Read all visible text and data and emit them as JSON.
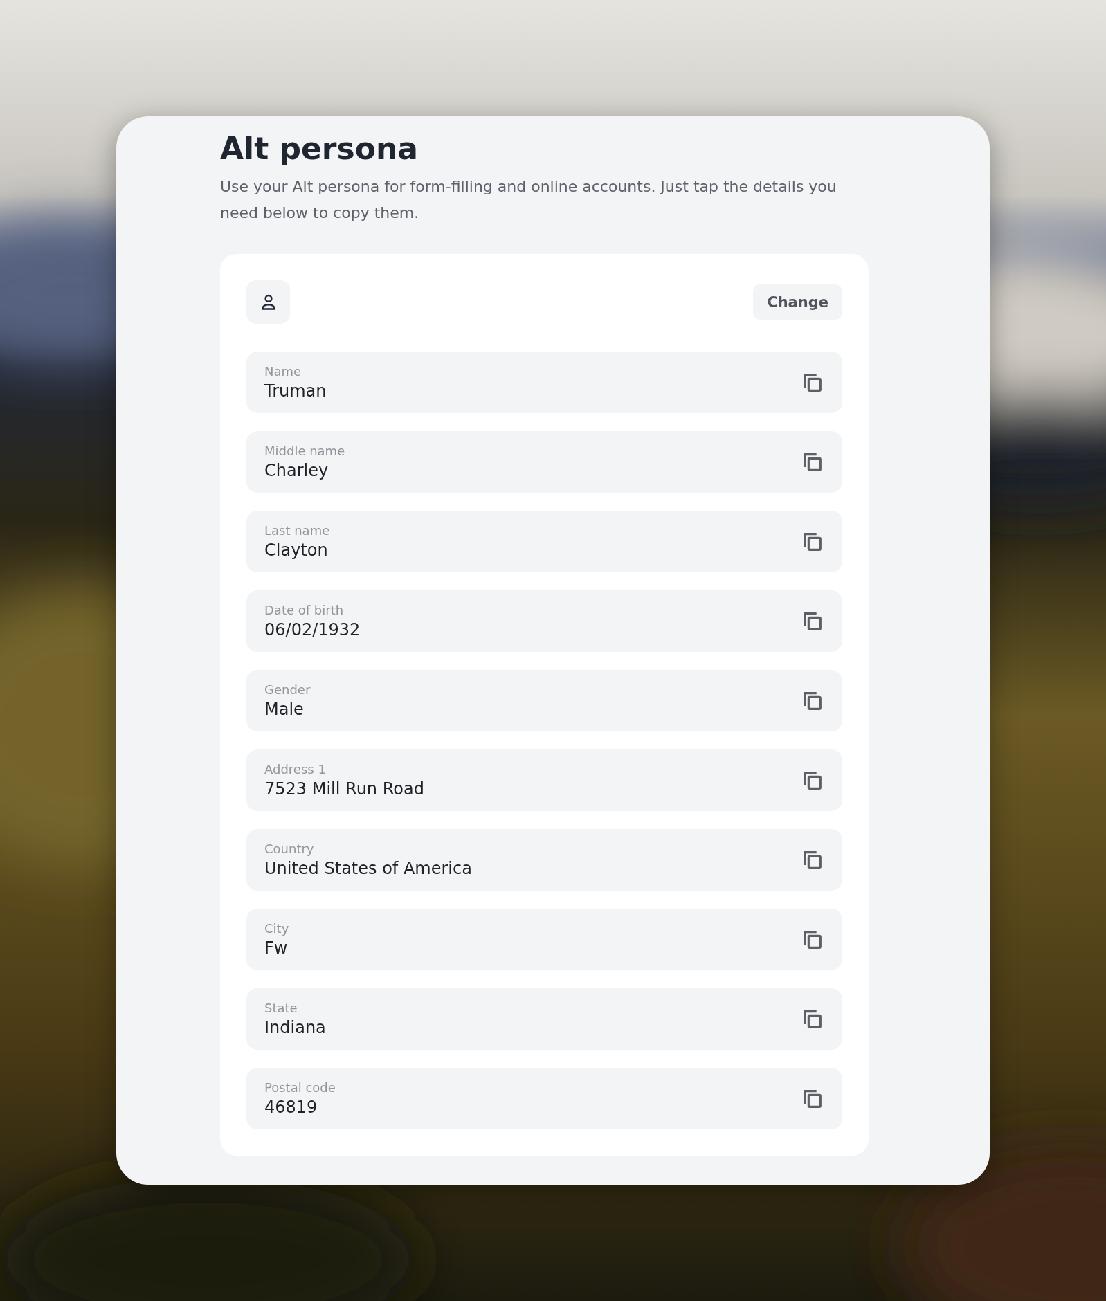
{
  "title": "Alt persona",
  "description": "Use your Alt persona for form-filling and online accounts. Just tap the details you need below to copy them.",
  "change_button": "Change",
  "fields": [
    {
      "label": "Name",
      "value": "Truman"
    },
    {
      "label": "Middle name",
      "value": "Charley"
    },
    {
      "label": "Last name",
      "value": "Clayton"
    },
    {
      "label": "Date of birth",
      "value": "06/02/1932"
    },
    {
      "label": "Gender",
      "value": "Male"
    },
    {
      "label": "Address 1",
      "value": "7523 Mill Run Road"
    },
    {
      "label": "Country",
      "value": "United States of America"
    },
    {
      "label": "City",
      "value": "Fw"
    },
    {
      "label": "State",
      "value": "Indiana"
    },
    {
      "label": "Postal code",
      "value": "46819"
    }
  ]
}
